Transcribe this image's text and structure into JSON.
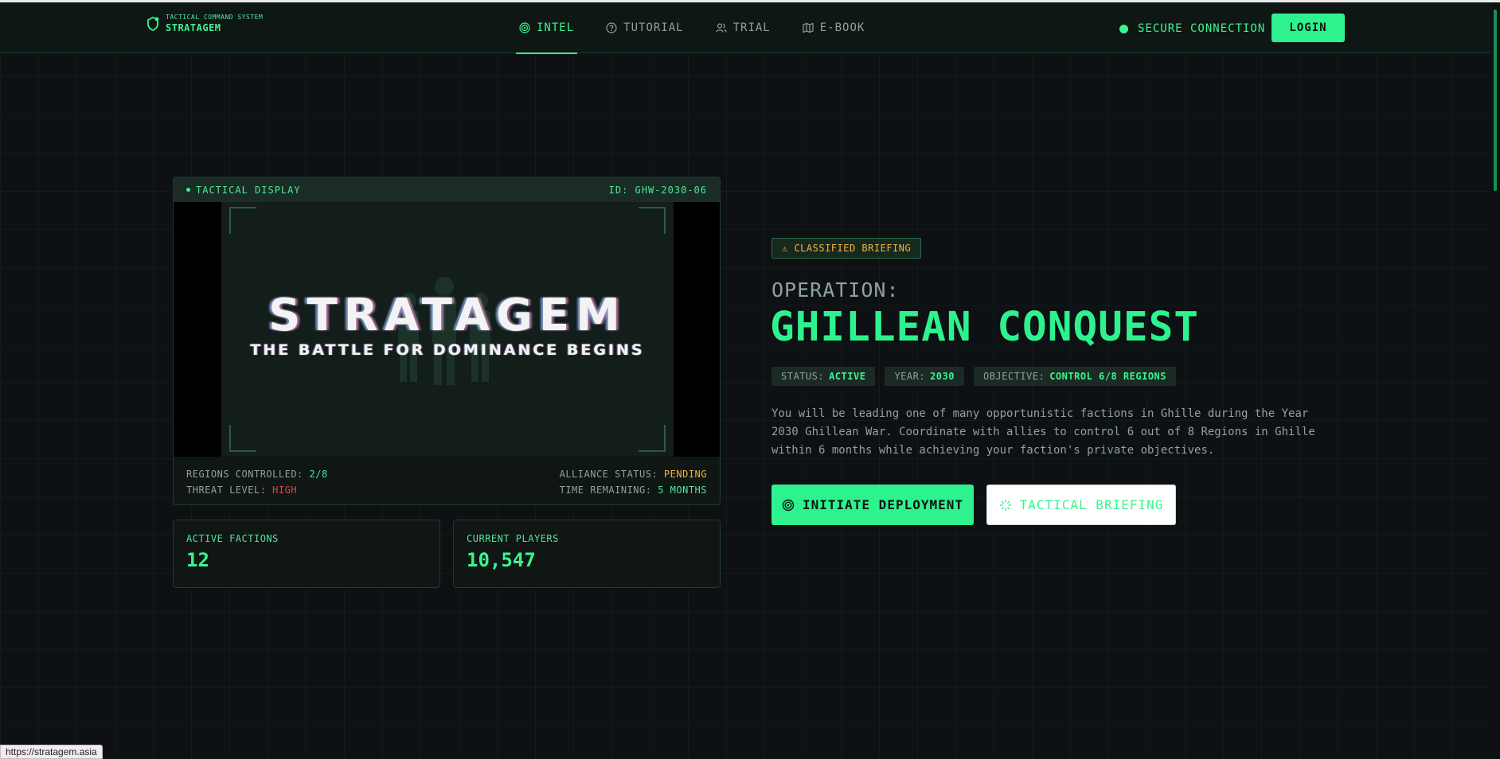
{
  "brand": {
    "subtitle": "TACTICAL COMMAND SYSTEM",
    "name": "STRATAGEM"
  },
  "nav": {
    "items": [
      {
        "label": "INTEL",
        "icon": "target-icon",
        "active": true
      },
      {
        "label": "TUTORIAL",
        "icon": "help-circle-icon",
        "active": false
      },
      {
        "label": "TRIAL",
        "icon": "users-icon",
        "active": false
      },
      {
        "label": "E-BOOK",
        "icon": "map-icon",
        "active": false
      }
    ],
    "secure_label": "SECURE CONNECTION",
    "login_label": "LOGIN"
  },
  "display": {
    "header_left": "TACTICAL DISPLAY",
    "header_right": "ID: GHW-2030-06",
    "logo_title": "STRATAGEM",
    "logo_subtitle": "THE BATTLE FOR DOMINANCE BEGINS",
    "regions_label": "REGIONS CONTROLLED:",
    "regions_value": "2/8",
    "threat_label": "THREAT LEVEL:",
    "threat_value": "HIGH",
    "alliance_label": "ALLIANCE STATUS:",
    "alliance_value": "PENDING",
    "time_label": "TIME REMAINING:",
    "time_value": "5 MONTHS"
  },
  "stats": {
    "factions_label": "ACTIVE FACTIONS",
    "factions_value": "12",
    "players_label": "CURRENT PLAYERS",
    "players_value": "10,547"
  },
  "briefing": {
    "badge": "⚠ CLASSIFIED BRIEFING",
    "op_label": "OPERATION:",
    "op_title": "GHILLEAN CONQUEST",
    "status_label": "STATUS:",
    "status_value": "ACTIVE",
    "year_label": "YEAR:",
    "year_value": "2030",
    "objective_label": "OBJECTIVE:",
    "objective_value": "CONTROL 6/8 REGIONS",
    "description": "You will be leading one of many opportunistic factions in Ghille during the Year 2030 Ghillean War. Coordinate with allies to control 6 out of 8 Regions in Ghille within 6 months while achieving your faction's private objectives.",
    "primary_button": "INITIATE DEPLOYMENT",
    "secondary_button": "TACTICAL BRIEFING"
  },
  "status_bar": {
    "url": "https://stratagem.asia"
  },
  "colors": {
    "accent": "#2ef28e",
    "warning": "#f2b33a",
    "danger": "#f0424a",
    "background": "#0d1113"
  }
}
